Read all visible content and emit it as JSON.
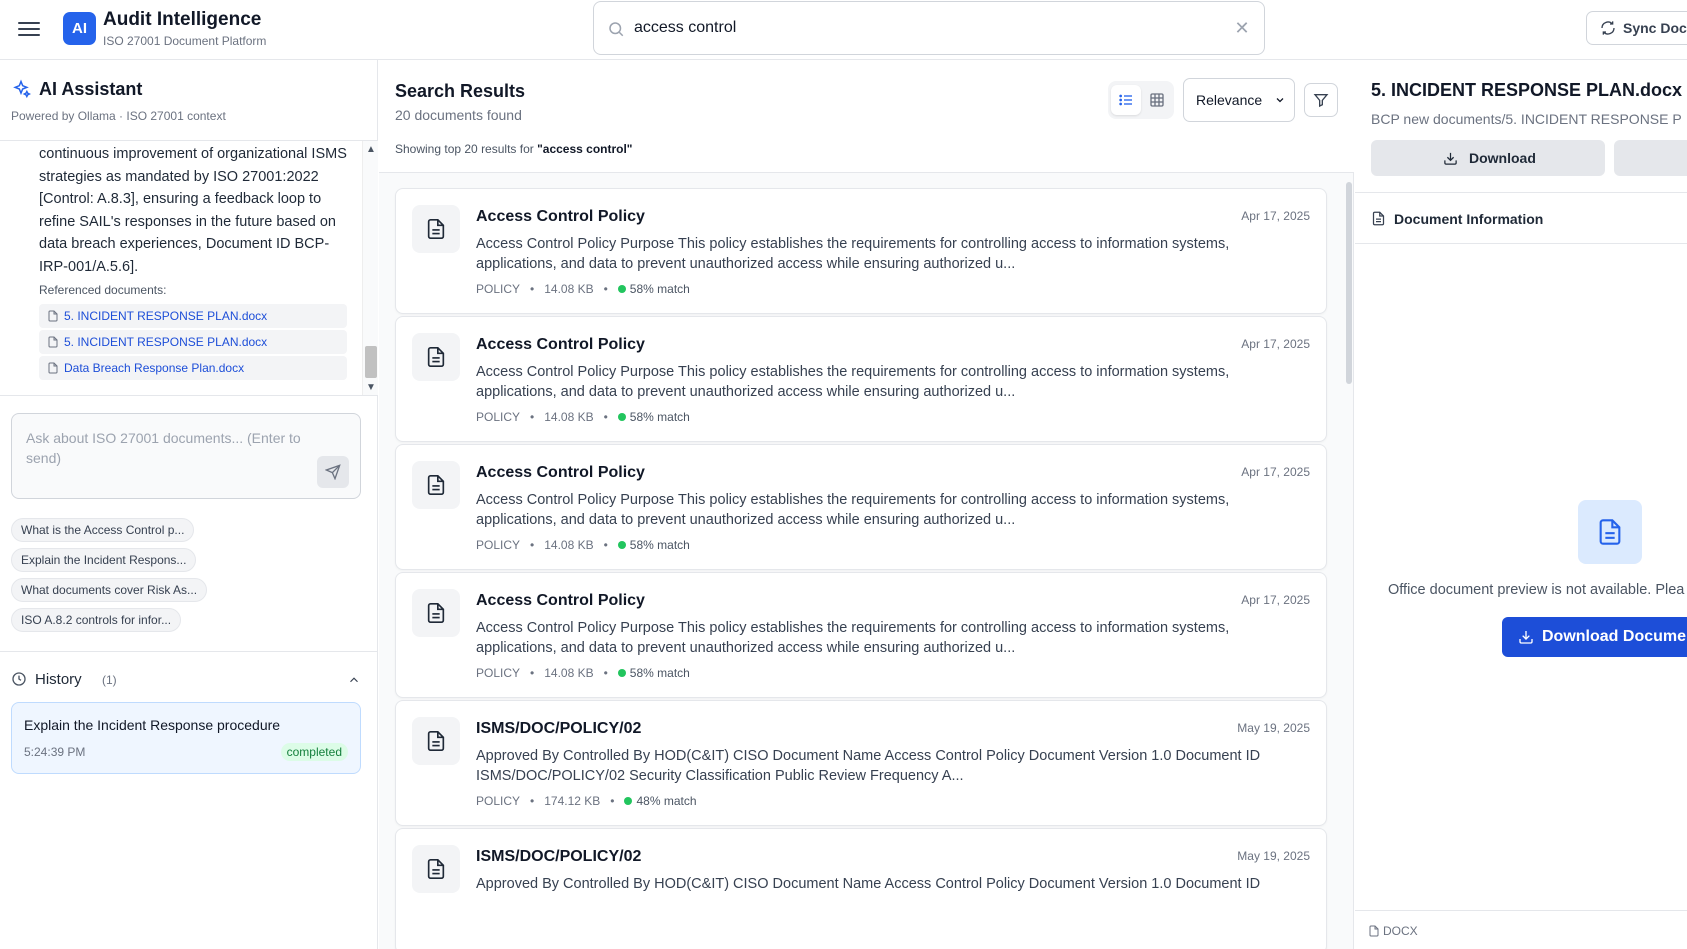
{
  "header": {
    "logo_text": "AI",
    "app_title": "Audit Intelligence",
    "app_subtitle": "ISO 27001 Document Platform",
    "search_value": "access control",
    "sync_label": "Sync Docs"
  },
  "assistant": {
    "title": "AI Assistant",
    "subtitle": "Powered by Ollama · ISO 27001 context",
    "message_text": "continuous improvement of organizational ISMS strategies as mandated by ISO 27001:2022 [Control: A.8.3], ensuring a feedback loop to refine SAIL's responses in the future based on data breach experiences, Document ID BCP-IRP-001/A.5.6].",
    "referenced_label": "Referenced documents:",
    "references": [
      "5. INCIDENT RESPONSE PLAN.docx",
      "5. INCIDENT RESPONSE PLAN.docx",
      "Data Breach Response Plan.docx"
    ],
    "input_placeholder": "Ask about ISO 27001 documents... (Enter to send)",
    "suggestions": [
      "What is the Access Control p...",
      "Explain the Incident Respons...",
      "What documents cover Risk As...",
      "ISO A.8.2 controls for infor..."
    ],
    "history": {
      "title": "History",
      "count": "(1)",
      "items": [
        {
          "query": "Explain the Incident Response procedure",
          "time": "5:24:39 PM",
          "status": "completed"
        }
      ]
    }
  },
  "results": {
    "title": "Search Results",
    "count_text": "20 documents found",
    "showing_prefix": "Showing top 20 results for ",
    "showing_query": "\"access control\"",
    "sort_value": "Relevance",
    "items": [
      {
        "title": "Access Control Policy",
        "date": "Apr 17, 2025",
        "snippet": "Access Control Policy Purpose This policy establishes the requirements for controlling access to information systems, applications, and data to prevent unauthorized access while ensuring authorized u...",
        "type": "POLICY",
        "size": "14.08 KB",
        "match": "58% match"
      },
      {
        "title": "Access Control Policy",
        "date": "Apr 17, 2025",
        "snippet": "Access Control Policy Purpose This policy establishes the requirements for controlling access to information systems, applications, and data to prevent unauthorized access while ensuring authorized u...",
        "type": "POLICY",
        "size": "14.08 KB",
        "match": "58% match"
      },
      {
        "title": "Access Control Policy",
        "date": "Apr 17, 2025",
        "snippet": "Access Control Policy Purpose This policy establishes the requirements for controlling access to information systems, applications, and data to prevent unauthorized access while ensuring authorized u...",
        "type": "POLICY",
        "size": "14.08 KB",
        "match": "58% match"
      },
      {
        "title": "Access Control Policy",
        "date": "Apr 17, 2025",
        "snippet": "Access Control Policy Purpose This policy establishes the requirements for controlling access to information systems, applications, and data to prevent unauthorized access while ensuring authorized u...",
        "type": "POLICY",
        "size": "14.08 KB",
        "match": "58% match"
      },
      {
        "title": "ISMS/DOC/POLICY/02",
        "date": "May 19, 2025",
        "snippet": "Approved By Controlled By HOD(C&IT) CISO Document Name Access Control Policy Document Version 1.0 Document ID ISMS/DOC/POLICY/02 Security Classification Public Review Frequency A...",
        "type": "POLICY",
        "size": "174.12 KB",
        "match": "48% match"
      },
      {
        "title": "ISMS/DOC/POLICY/02",
        "date": "May 19, 2025",
        "snippet": "Approved By Controlled By HOD(C&IT) CISO Document Name Access Control Policy Document Version 1.0 Document ID",
        "type": "",
        "size": "",
        "match": ""
      }
    ]
  },
  "preview": {
    "title": "5. INCIDENT RESPONSE PLAN.docx",
    "path": "BCP new documents/5. INCIDENT RESPONSE P",
    "download_label": "Download",
    "info_label": "Document Information",
    "unavailable_message": "Office document preview is not available. Plea",
    "download_document_label": "Download Docume",
    "format": "DOCX"
  },
  "colors": {
    "accent": "#2563eb",
    "accent_dark": "#1d4ed8",
    "match_dot": "#22c55e",
    "status_completed_bg": "#dcfce7",
    "status_completed_text": "#15803d"
  },
  "icons": {
    "menu": "hamburger-icon",
    "search": "search-icon",
    "clear": "close-icon",
    "sync": "refresh-icon",
    "assistant": "sparkles-icon",
    "document": "document-icon",
    "send": "send-icon",
    "history": "clock-icon",
    "collapse": "chevron-up-icon",
    "list_view": "list-icon",
    "grid_view": "grid-icon",
    "filter": "filter-icon",
    "download": "download-icon"
  }
}
